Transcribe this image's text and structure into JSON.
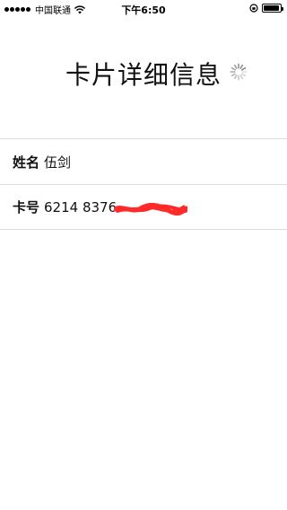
{
  "status_bar": {
    "carrier": "中国联通",
    "time": "下午6:50",
    "battery_level": 0.95
  },
  "page": {
    "title": "卡片详细信息"
  },
  "fields": [
    {
      "label": "姓名",
      "value": "伍剑"
    },
    {
      "label": "卡号",
      "value": "6214 8376"
    }
  ],
  "colors": {
    "redaction": "#ff2a2a",
    "divider": "#dcdcdc"
  },
  "icons": [
    "signal-dots-icon",
    "wifi-icon",
    "rotation-lock-icon",
    "battery-icon",
    "loading-spinner-icon"
  ]
}
